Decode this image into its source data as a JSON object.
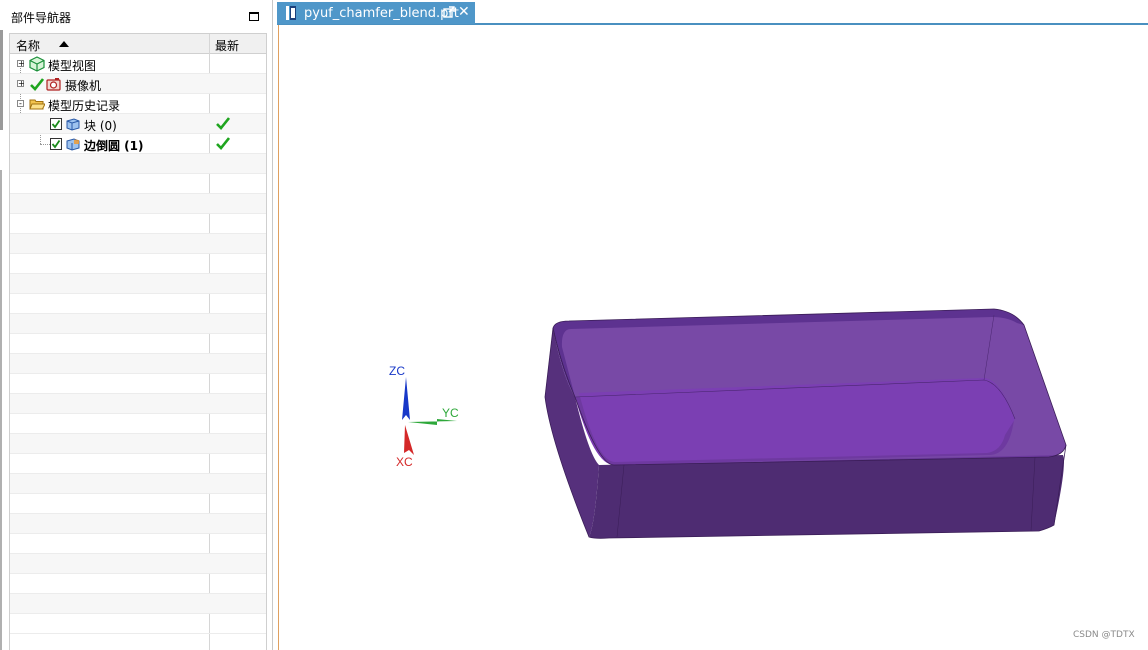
{
  "navigator": {
    "title": "部件导航器",
    "columns": {
      "name": "名称",
      "latest": "最新"
    },
    "items": [
      {
        "label": "模型视图",
        "icon": "model-views-icon",
        "expander": "+"
      },
      {
        "label": "摄像机",
        "icon": "camera-icon",
        "expander": "+"
      },
      {
        "label": "模型历史记录",
        "icon": "folder-open-icon",
        "expander": "-"
      },
      {
        "label": "块 (0)",
        "icon": "block-feature-icon",
        "checked": true,
        "latest": true
      },
      {
        "label": "边倒圆 (1)",
        "icon": "edge-blend-icon",
        "checked": true,
        "latest": true,
        "bold": true
      }
    ]
  },
  "tab": {
    "title": "pyuf_chamfer_blend.prt",
    "close_symbol": "✕",
    "icon": "part-file-icon"
  },
  "triad": {
    "z": "ZC",
    "y": "YC",
    "x": "XC"
  },
  "colors": {
    "part_top": "#6c3a9e",
    "part_side": "#4f2d73",
    "tab": "#4f97c9",
    "check": "#1fa51f"
  },
  "watermark": "CSDN @TDTX"
}
